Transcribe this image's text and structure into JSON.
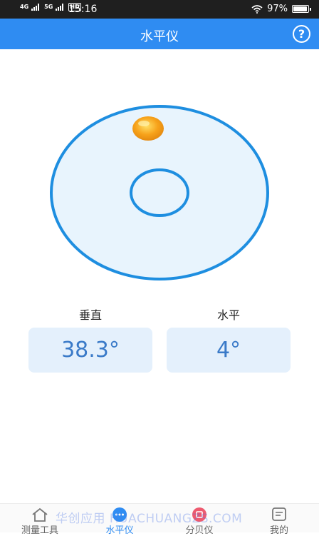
{
  "status_bar": {
    "network_1": "4G",
    "network_2": "5G",
    "hd": "HD",
    "time": "15:16",
    "battery_text": "97%",
    "battery_level": 0.97
  },
  "header": {
    "title": "水平仪",
    "help_icon": "?"
  },
  "level": {
    "bubble_color": "#f7a21a",
    "ring_color": "#1e8ee0"
  },
  "readouts": {
    "vertical_label": "垂直",
    "vertical_value": "38.3°",
    "horizontal_label": "水平",
    "horizontal_value": "4°"
  },
  "bottom_nav": {
    "items": [
      {
        "label": "测量工具",
        "icon": "home-icon"
      },
      {
        "label": "水平仪",
        "icon": "chat-bubble-icon"
      },
      {
        "label": "分贝仪",
        "icon": "decibel-icon"
      },
      {
        "label": "我的",
        "icon": "message-icon"
      }
    ],
    "active_index": 1
  },
  "watermark": "华创应用 HUACHUANGZS.COM"
}
